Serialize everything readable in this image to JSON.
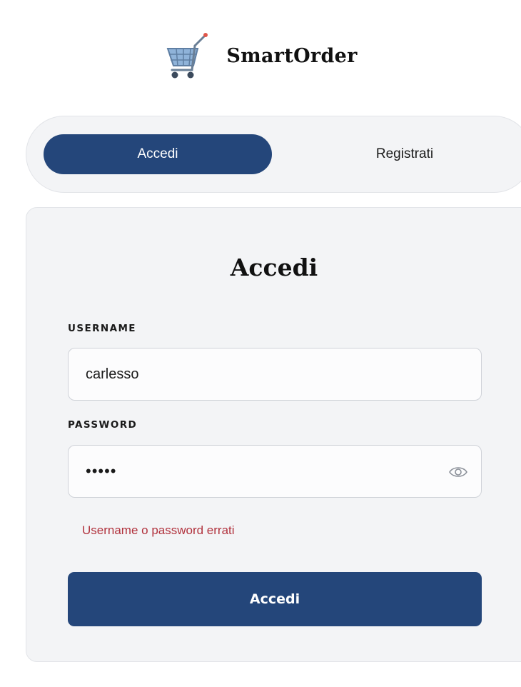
{
  "brand": {
    "name": "SmartOrder",
    "logo_icon": "shopping-cart-icon"
  },
  "tabs": [
    {
      "label": "Accedi",
      "active": true
    },
    {
      "label": "Registrati",
      "active": false
    }
  ],
  "login_form": {
    "title": "Accedi",
    "username": {
      "label": "USERNAME",
      "value": "carlesso"
    },
    "password": {
      "label": "PASSWORD",
      "value": "•••••",
      "toggle_icon": "eye-icon"
    },
    "error": "Username o password errati",
    "submit_label": "Accedi"
  },
  "colors": {
    "primary": "#24467a",
    "error": "#b1323d",
    "panel": "#f3f4f6"
  }
}
